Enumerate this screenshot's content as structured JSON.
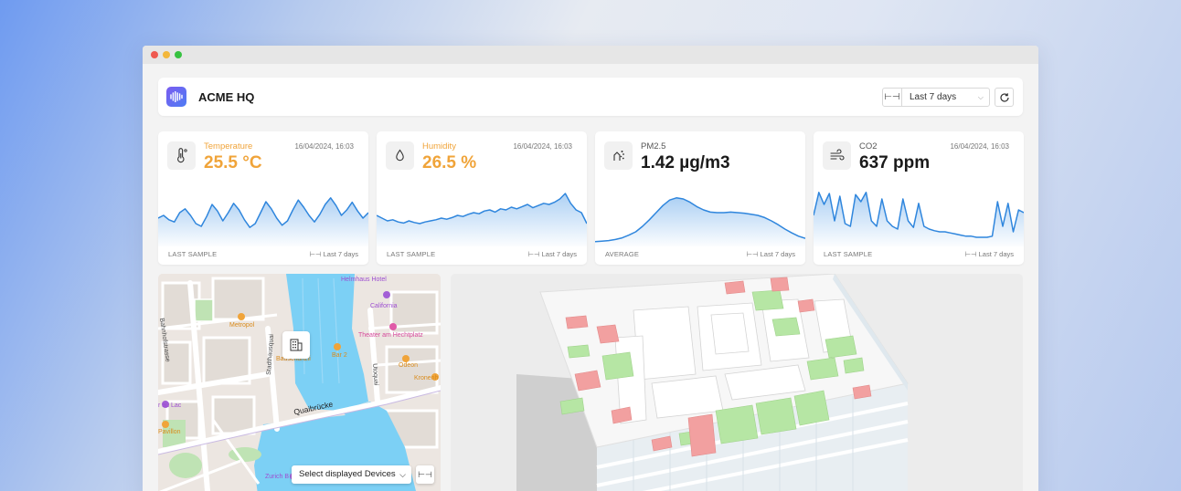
{
  "app": {
    "site_title": "ACME HQ",
    "date_range": "Last 7 days"
  },
  "cards": [
    {
      "label": "Temperature",
      "value": "25.5 °C",
      "timestamp": "16/04/2024, 16:03",
      "footer_left": "LAST SAMPLE",
      "footer_right": "Last 7 days",
      "icon": "thermometer-icon",
      "accent": "#f0a43a",
      "trend": [
        0.45,
        0.5,
        0.42,
        0.38,
        0.55,
        0.62,
        0.5,
        0.35,
        0.3,
        0.48,
        0.7,
        0.58,
        0.4,
        0.55,
        0.72,
        0.6,
        0.42,
        0.28,
        0.35,
        0.55,
        0.75,
        0.62,
        0.45,
        0.32,
        0.4,
        0.6,
        0.78,
        0.65,
        0.5,
        0.38,
        0.52,
        0.7,
        0.82,
        0.68,
        0.5,
        0.6,
        0.74,
        0.58,
        0.45,
        0.55
      ]
    },
    {
      "label": "Humidity",
      "value": "26.5 %",
      "timestamp": "16/04/2024, 16:03",
      "footer_left": "LAST SAMPLE",
      "footer_right": "Last 7 days",
      "icon": "droplet-icon",
      "accent": "#f0a43a",
      "trend": [
        0.5,
        0.45,
        0.4,
        0.42,
        0.38,
        0.36,
        0.4,
        0.37,
        0.35,
        0.38,
        0.4,
        0.42,
        0.45,
        0.43,
        0.46,
        0.5,
        0.48,
        0.52,
        0.55,
        0.53,
        0.58,
        0.6,
        0.56,
        0.62,
        0.6,
        0.65,
        0.62,
        0.66,
        0.7,
        0.64,
        0.68,
        0.72,
        0.7,
        0.74,
        0.8,
        0.9,
        0.72,
        0.6,
        0.55,
        0.35
      ]
    },
    {
      "label": "PM2.5",
      "value": "1.42 µg/m3",
      "timestamp": "",
      "footer_left": "AVERAGE",
      "footer_right": "Last 7 days",
      "icon": "particles-icon",
      "accent": "#1a1a1a",
      "trend": [
        0.02,
        0.03,
        0.04,
        0.06,
        0.09,
        0.14,
        0.2,
        0.3,
        0.42,
        0.55,
        0.68,
        0.78,
        0.82,
        0.8,
        0.74,
        0.66,
        0.6,
        0.56,
        0.55,
        0.55,
        0.56,
        0.55,
        0.54,
        0.52,
        0.5,
        0.46,
        0.4,
        0.33,
        0.25,
        0.18,
        0.12,
        0.08
      ]
    },
    {
      "label": "CO2",
      "value": "637 ppm",
      "timestamp": "16/04/2024, 16:03",
      "footer_left": "LAST SAMPLE",
      "footer_right": "Last 7 days",
      "icon": "wind-icon",
      "accent": "#1a1a1a",
      "trend": [
        0.5,
        0.92,
        0.7,
        0.9,
        0.4,
        0.85,
        0.35,
        0.3,
        0.88,
        0.75,
        0.92,
        0.4,
        0.3,
        0.8,
        0.4,
        0.3,
        0.25,
        0.8,
        0.4,
        0.28,
        0.72,
        0.3,
        0.25,
        0.22,
        0.2,
        0.2,
        0.18,
        0.16,
        0.14,
        0.12,
        0.12,
        0.1,
        0.1,
        0.1,
        0.12,
        0.75,
        0.3,
        0.72,
        0.2,
        0.6,
        0.55
      ]
    }
  ],
  "map": {
    "labels": {
      "helmhaus": "Helmhaus Hotel",
      "metropol": "Metropol",
      "california": "California",
      "theater": "Theater am Hechtplatz",
      "bauschanzli": "Bauschänzli",
      "bar": "Bar 2",
      "odeon": "Odeon",
      "kronenhalle": "Kronenh",
      "au_lac": "r au Lac",
      "pavillon": "Pavillon",
      "zurich": "Zurich B",
      "quaibrucke": "Quaibrücke",
      "bahnhofstrasse": "Bahnhofstrasse",
      "stadthausquai": "Stadthausquai",
      "utoquai": "Utoquai"
    },
    "device_select": "Select displayed Devices"
  }
}
